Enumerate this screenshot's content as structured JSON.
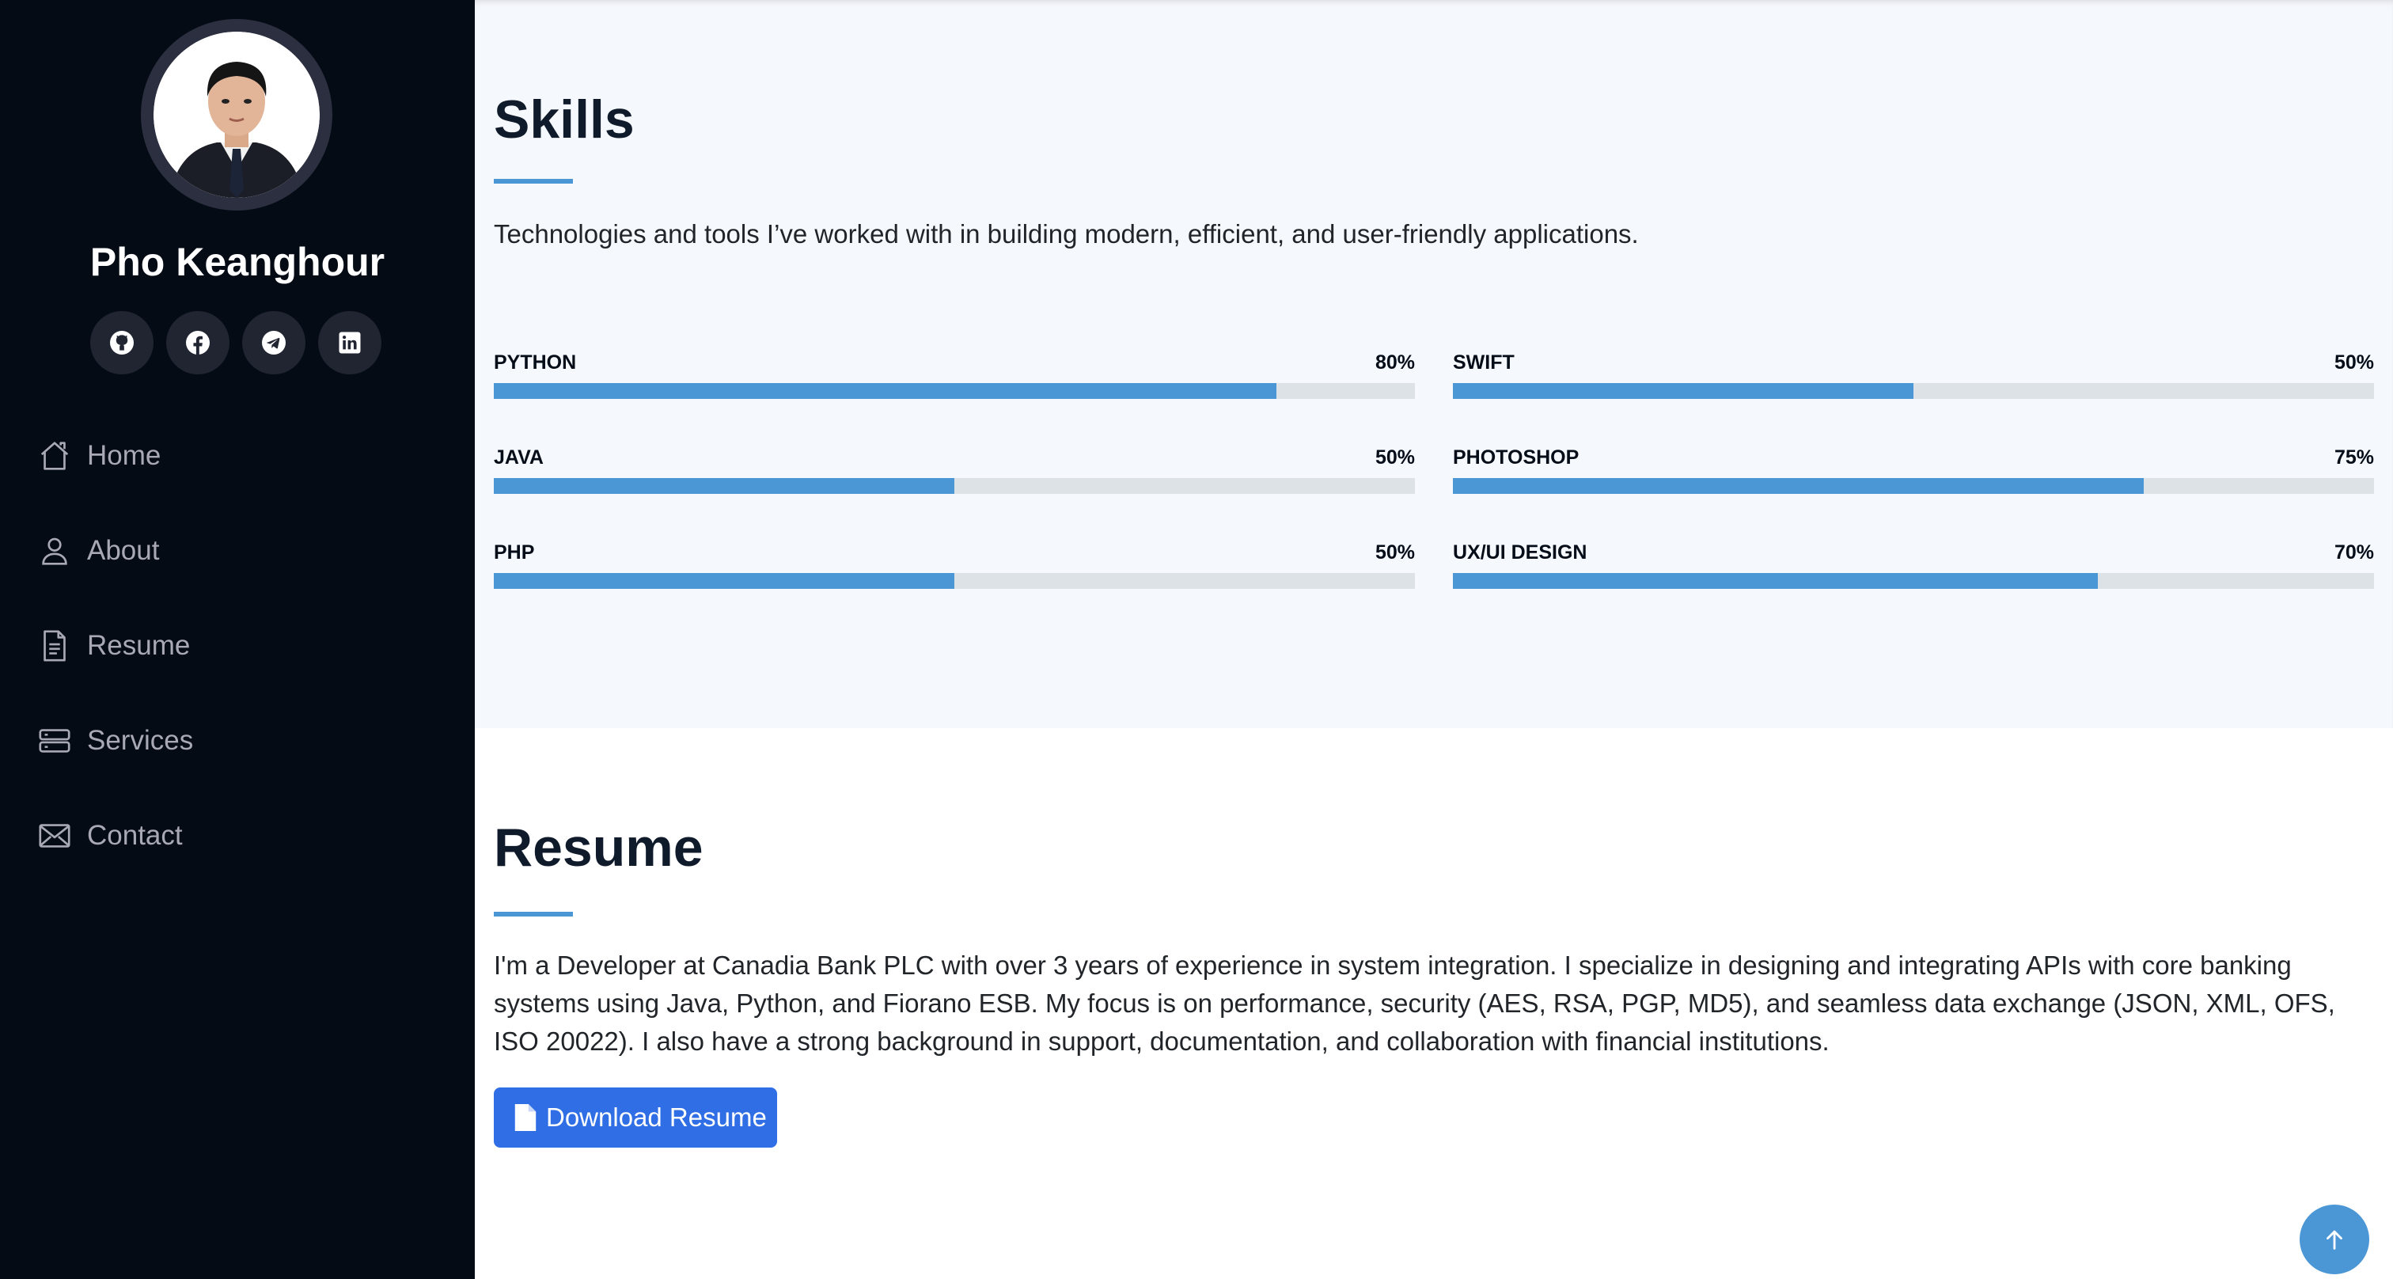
{
  "profile": {
    "name": "Pho Keanghour",
    "avatar_icon": "profile-photo"
  },
  "socials": [
    {
      "icon": "github-icon"
    },
    {
      "icon": "facebook-icon"
    },
    {
      "icon": "telegram-icon"
    },
    {
      "icon": "linkedin-icon"
    }
  ],
  "nav": {
    "items": [
      {
        "label": "Home",
        "icon": "home-icon"
      },
      {
        "label": "About",
        "icon": "person-icon"
      },
      {
        "label": "Resume",
        "icon": "file-text-icon"
      },
      {
        "label": "Services",
        "icon": "server-icon"
      },
      {
        "label": "Contact",
        "icon": "envelope-icon"
      }
    ]
  },
  "skills": {
    "title": "Skills",
    "description": "Technologies and tools I’ve worked with in building modern, efficient, and user-friendly applications.",
    "items": [
      {
        "name": "PYTHON",
        "value_label": "80%",
        "level": 0.85
      },
      {
        "name": "SWIFT",
        "value_label": "50%",
        "level": 0.5
      },
      {
        "name": "JAVA",
        "value_label": "50%",
        "level": 0.5
      },
      {
        "name": "PHOTOSHOP",
        "value_label": "75%",
        "level": 0.75
      },
      {
        "name": "PHP",
        "value_label": "50%",
        "level": 0.5
      },
      {
        "name": "UX/UI DESIGN",
        "value_label": "70%",
        "level": 0.7
      }
    ]
  },
  "resume": {
    "title": "Resume",
    "description": "I'm a Developer at Canadia Bank PLC with over 3 years of experience in system integration. I specialize in designing and integrating APIs with core banking systems using Java, Python, and Fiorano ESB. My focus is on performance, security (AES, RSA, PGP, MD5), and seamless data exchange (JSON, XML, OFS, ISO 20022). I also have a strong background in support, documentation, and collaboration with financial institutions.",
    "download_label": "Download Resume"
  },
  "colors": {
    "sidebar_bg": "#040b14",
    "accent": "#4b97d6",
    "button": "#2f6ee5",
    "skills_bg": "#f5f8fd"
  }
}
